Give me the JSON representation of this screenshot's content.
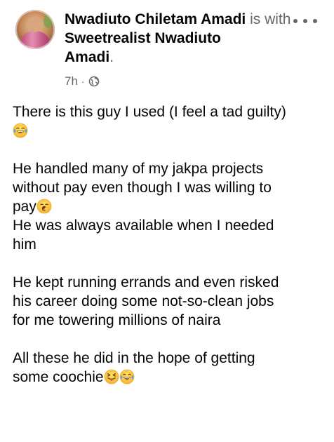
{
  "post": {
    "author": "Nwadiuto Chiletam Amadi",
    "with_word": " is with ",
    "tagged": "Sweetrealist Nwadiuto Amadi",
    "tagged_line1": "Sweetrealist Nwadiuto",
    "tagged_line2": "Amadi",
    "period": ".",
    "time": "7h",
    "separator": "·",
    "audience_icon": "globe-icon",
    "more_icon": "more-options-icon",
    "paragraphs": [
      {
        "lines": [
          {
            "text": "There is this guy I used (I feel a tad guilty)",
            "emoji_after": []
          },
          {
            "text": "",
            "emoji_after": [
              "laugh-cry-emoji"
            ]
          }
        ]
      },
      {
        "lines": [
          {
            "text": "He handled many of my jakpa projects",
            "emoji_after": []
          },
          {
            "text": "without pay even though I was willing to",
            "emoji_after": []
          },
          {
            "text": "pay",
            "emoji_after": [
              "yawning-emoji"
            ]
          },
          {
            "text": "He was always available when I needed",
            "emoji_after": []
          },
          {
            "text": "him",
            "emoji_after": []
          }
        ]
      },
      {
        "lines": [
          {
            "text": "He kept running errands and even risked",
            "emoji_after": []
          },
          {
            "text": "his career doing some not-so-clean jobs",
            "emoji_after": []
          },
          {
            "text": "for me towering millions of naira",
            "emoji_after": []
          }
        ]
      },
      {
        "lines": [
          {
            "text": "All these he did in the hope of getting",
            "emoji_after": []
          },
          {
            "text": "some coochie",
            "emoji_after": [
              "squinting-tongue-emoji",
              "laugh-cry-emoji"
            ]
          }
        ]
      }
    ]
  },
  "colors": {
    "text": "#050505",
    "muted": "#65676b",
    "background": "#ffffff"
  }
}
